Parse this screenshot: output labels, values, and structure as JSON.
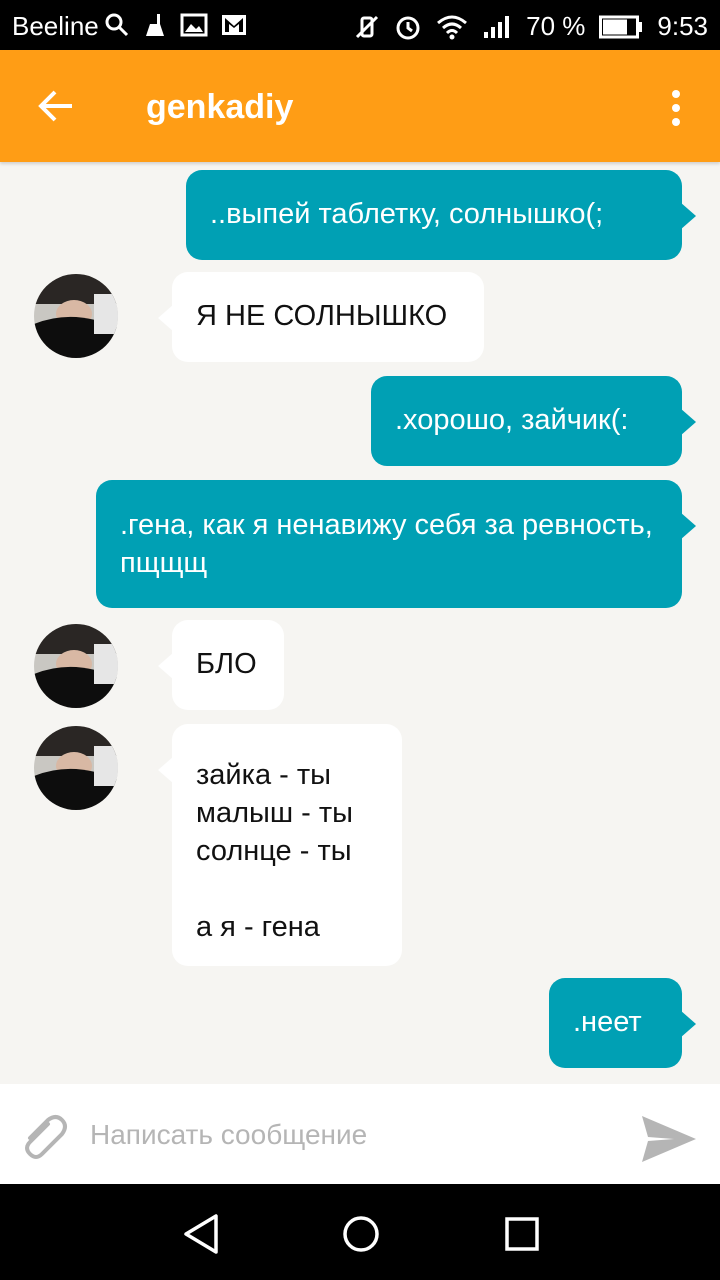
{
  "status_bar": {
    "carrier": "Beeline",
    "battery": "70 %",
    "time": "9:53",
    "icons_left": [
      "search-icon",
      "cleaner-icon",
      "gallery-icon",
      "gmail-icon"
    ],
    "icons_right": [
      "vibrate-icon",
      "alarm-icon",
      "wifi-icon",
      "signal-icon",
      "battery-icon"
    ]
  },
  "header": {
    "title": "genkadiy",
    "icons": [
      "back-arrow-icon",
      "more-vert-icon"
    ]
  },
  "messages": [
    {
      "dir": "out",
      "text": "..выпей таблетку, солнышко(;"
    },
    {
      "dir": "in",
      "text": "Я НЕ СОЛНЫШКО"
    },
    {
      "dir": "out",
      "text": ".хорошо, зайчик(:"
    },
    {
      "dir": "out",
      "text": ".гена, как я ненавижу себя за ревность, пщщщ"
    },
    {
      "dir": "in",
      "text": "БЛО"
    },
    {
      "dir": "in",
      "lines": [
        "зайка - ты",
        "малыш - ты",
        "солнце - ты",
        "",
        "а я - гена"
      ]
    },
    {
      "dir": "out",
      "text": ".неет"
    }
  ],
  "composer": {
    "placeholder": "Написать сообщение",
    "icons": [
      "attach-icon",
      "send-icon"
    ]
  },
  "nav_bar": {
    "icons": [
      "back-triangle-icon",
      "home-circle-icon",
      "recents-square-icon"
    ]
  },
  "colors": {
    "accent": "#ff9d15",
    "outgoing_bubble": "#00a0b4",
    "incoming_bubble": "#ffffff",
    "background": "#f6f5f2"
  }
}
